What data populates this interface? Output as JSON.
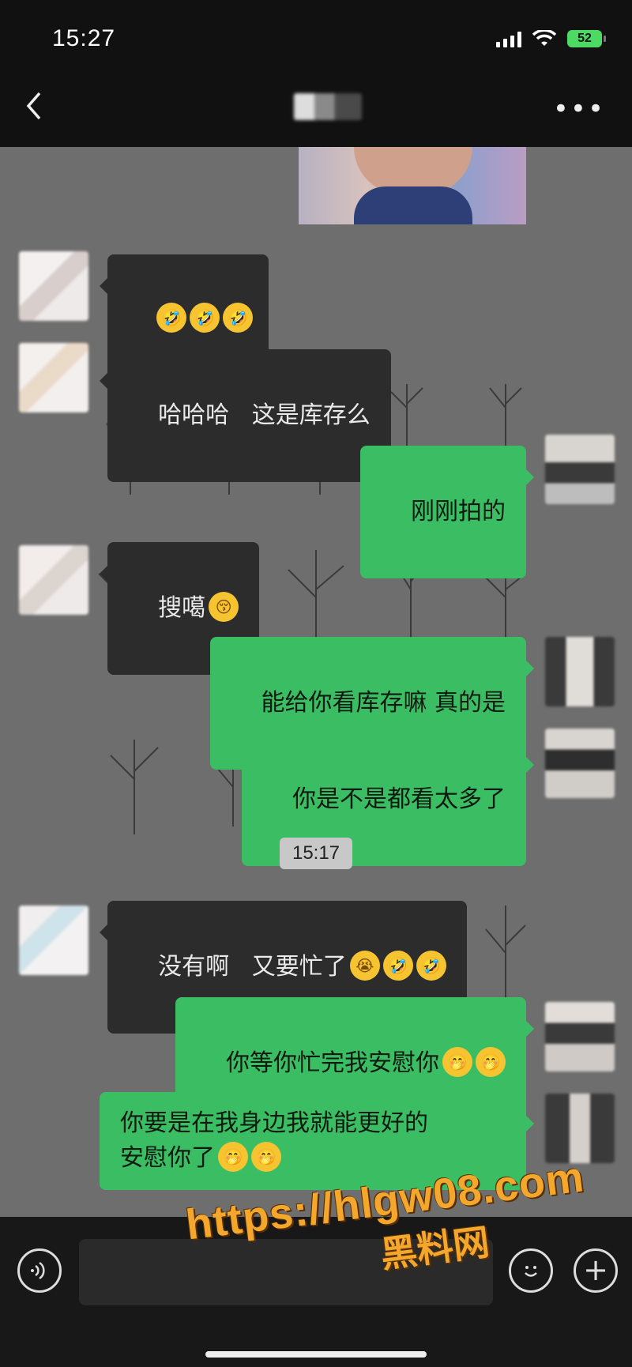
{
  "status_bar": {
    "time": "15:27",
    "battery": "52"
  },
  "header": {
    "back_icon": "chevron-left-icon",
    "more_label": "•••"
  },
  "messages": [
    {
      "side": "in",
      "text": "",
      "emojis": [
        "🤣",
        "🤣",
        "🤣"
      ]
    },
    {
      "side": "in",
      "text": "哈哈哈   这是库存么",
      "emojis": []
    },
    {
      "side": "out",
      "text": "刚刚拍的",
      "emojis": []
    },
    {
      "side": "in",
      "text": "搜噶",
      "emojis": [
        "😚"
      ]
    },
    {
      "side": "out",
      "text": "能给你看库存嘛 真的是",
      "emojis": []
    },
    {
      "side": "out",
      "text": "你是不是都看太多了",
      "emojis": []
    },
    {
      "side": "in",
      "text": "没有啊   又要忙了",
      "emojis": [
        "😭",
        "🤣",
        "🤣"
      ]
    },
    {
      "side": "out",
      "text": "你等你忙完我安慰你",
      "emojis": [
        "🤭",
        "🤭"
      ]
    },
    {
      "side": "out",
      "text": "你要是在我身边我就能更好的\n安慰你了",
      "emojis": [
        "🤭",
        "🤭"
      ]
    }
  ],
  "timestamp": "15:17",
  "watermark": {
    "url": "https://hlgw08.com",
    "label": "黑料网"
  },
  "colors": {
    "incoming_bubble": "#2c2c2c",
    "outgoing_bubble": "#3bbd63",
    "chat_bg": "#6e6e6e",
    "watermark": "#f3a72c"
  }
}
